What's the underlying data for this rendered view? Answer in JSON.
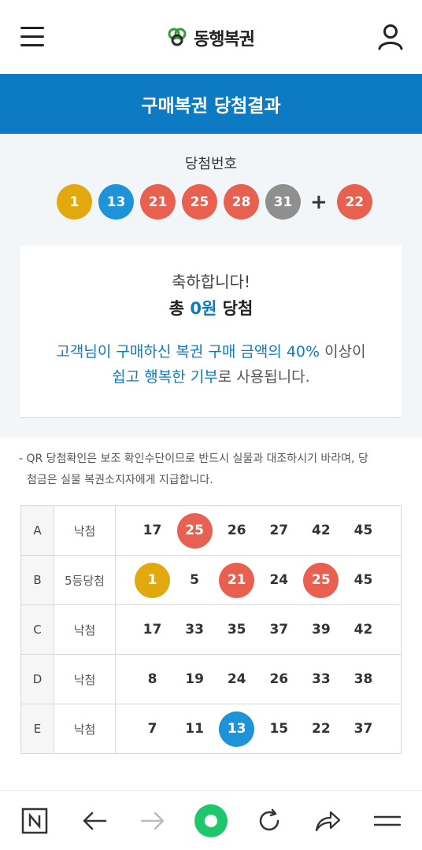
{
  "header": {
    "logo_text": "동행복권",
    "menu_icon": "hamburger-menu-icon",
    "user_icon": "user-icon"
  },
  "banner": {
    "title": "구매복권 당첨결과"
  },
  "winning": {
    "title": "당첨번호",
    "numbers": [
      {
        "value": "1",
        "color": "#e2a90f"
      },
      {
        "value": "13",
        "color": "#1f93d8"
      },
      {
        "value": "21",
        "color": "#e8604f"
      },
      {
        "value": "25",
        "color": "#e8604f"
      },
      {
        "value": "28",
        "color": "#e8604f"
      },
      {
        "value": "31",
        "color": "#8f8f8f"
      }
    ],
    "plus": "+",
    "bonus": {
      "value": "22",
      "color": "#e8604f"
    }
  },
  "result_card": {
    "congrats": "축하합니다!",
    "amount_prefix": "총 ",
    "amount_value": "0원",
    "amount_suffix": " 당첨",
    "line1_blue": "고객님이 구매하신 복권 구매 금액의 40%",
    "line1_rest": " 이상이",
    "line2_blue": "쉽고 행복한 기부",
    "line2_rest": "로 사용됩니다."
  },
  "notice": {
    "line1": "- QR 당첨확인은 보조 확인수단이므로 반드시 실물과 대조하시기 바라며, 당",
    "line2": "첨금은 실물 복권소지자에게 지급합니다."
  },
  "games": [
    {
      "letter": "A",
      "result": "낙첨",
      "numbers": [
        {
          "v": "17",
          "hit": false
        },
        {
          "v": "25",
          "hit": true,
          "color": "#e8604f"
        },
        {
          "v": "26",
          "hit": false
        },
        {
          "v": "27",
          "hit": false
        },
        {
          "v": "42",
          "hit": false
        },
        {
          "v": "45",
          "hit": false
        }
      ]
    },
    {
      "letter": "B",
      "result": "5등당첨",
      "numbers": [
        {
          "v": "1",
          "hit": true,
          "color": "#e2a90f"
        },
        {
          "v": "5",
          "hit": false
        },
        {
          "v": "21",
          "hit": true,
          "color": "#e8604f"
        },
        {
          "v": "24",
          "hit": false
        },
        {
          "v": "25",
          "hit": true,
          "color": "#e8604f"
        },
        {
          "v": "45",
          "hit": false
        }
      ]
    },
    {
      "letter": "C",
      "result": "낙첨",
      "numbers": [
        {
          "v": "17",
          "hit": false
        },
        {
          "v": "33",
          "hit": false
        },
        {
          "v": "35",
          "hit": false
        },
        {
          "v": "37",
          "hit": false
        },
        {
          "v": "39",
          "hit": false
        },
        {
          "v": "42",
          "hit": false
        }
      ]
    },
    {
      "letter": "D",
      "result": "낙첨",
      "numbers": [
        {
          "v": "8",
          "hit": false
        },
        {
          "v": "19",
          "hit": false
        },
        {
          "v": "24",
          "hit": false
        },
        {
          "v": "26",
          "hit": false
        },
        {
          "v": "33",
          "hit": false
        },
        {
          "v": "38",
          "hit": false
        }
      ]
    },
    {
      "letter": "E",
      "result": "낙첨",
      "numbers": [
        {
          "v": "7",
          "hit": false
        },
        {
          "v": "11",
          "hit": false
        },
        {
          "v": "13",
          "hit": true,
          "color": "#1f93d8"
        },
        {
          "v": "15",
          "hit": false
        },
        {
          "v": "22",
          "hit": false
        },
        {
          "v": "37",
          "hit": false
        }
      ]
    }
  ],
  "bottom_bar": {
    "items": [
      "naver-home-icon",
      "back-arrow-icon",
      "forward-arrow-icon",
      "green-dot-icon",
      "refresh-icon",
      "share-icon",
      "menu-lines-icon"
    ],
    "accent": "#1ec76b"
  }
}
